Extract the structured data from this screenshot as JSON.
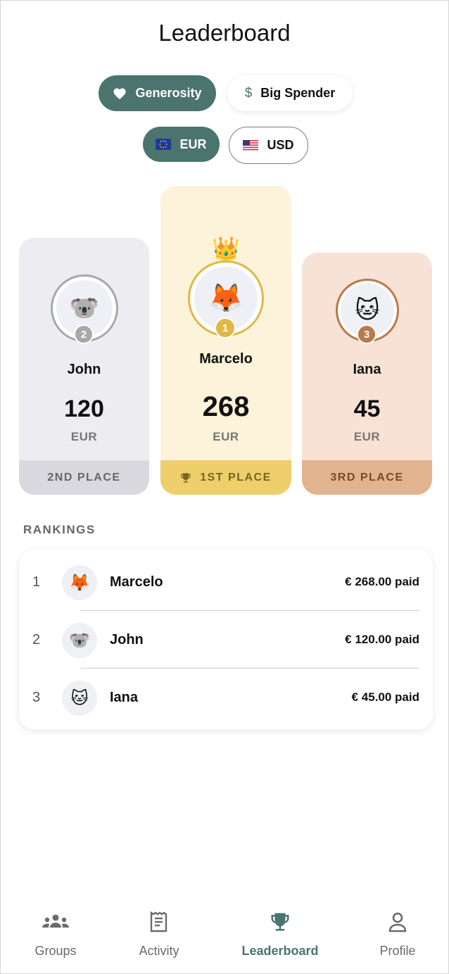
{
  "header": {
    "title": "Leaderboard"
  },
  "filters": {
    "mode": [
      {
        "label": "Generosity",
        "icon": "heart-icon",
        "selected": true
      },
      {
        "label": "Big Spender",
        "icon": "dollar-icon",
        "selected": false
      }
    ],
    "currency": [
      {
        "label": "EUR",
        "icon": "eu-flag-icon",
        "selected": true
      },
      {
        "label": "USD",
        "icon": "us-flag-icon",
        "selected": false
      }
    ]
  },
  "podium": {
    "first": {
      "name": "Marcelo",
      "score": "268",
      "currency": "EUR",
      "rank": "1",
      "place_label": "1ST PLACE",
      "avatar": "🦊"
    },
    "second": {
      "name": "John",
      "score": "120",
      "currency": "EUR",
      "rank": "2",
      "place_label": "2ND PLACE",
      "avatar": "🐨"
    },
    "third": {
      "name": "Iana",
      "score": "45",
      "currency": "EUR",
      "rank": "3",
      "place_label": "3RD PLACE",
      "avatar": "🐱"
    },
    "crown": "👑"
  },
  "rankings": {
    "title": "RANKINGS",
    "rows": [
      {
        "rank": "1",
        "avatar": "🦊",
        "name": "Marcelo",
        "amount": "€ 268.00 paid"
      },
      {
        "rank": "2",
        "avatar": "🐨",
        "name": "John",
        "amount": "€ 120.00 paid"
      },
      {
        "rank": "3",
        "avatar": "🐱",
        "name": "Iana",
        "amount": "€ 45.00 paid"
      }
    ]
  },
  "nav": {
    "items": [
      {
        "label": "Groups",
        "icon": "groups-icon",
        "active": false
      },
      {
        "label": "Activity",
        "icon": "receipt-icon",
        "active": false
      },
      {
        "label": "Leaderboard",
        "icon": "trophy-icon",
        "active": true
      },
      {
        "label": "Profile",
        "icon": "person-icon",
        "active": false
      }
    ]
  },
  "colors": {
    "accent": "#4b746e",
    "gold": "#e0b84a",
    "silver": "#a8a8a8",
    "bronze": "#b87a4a"
  }
}
